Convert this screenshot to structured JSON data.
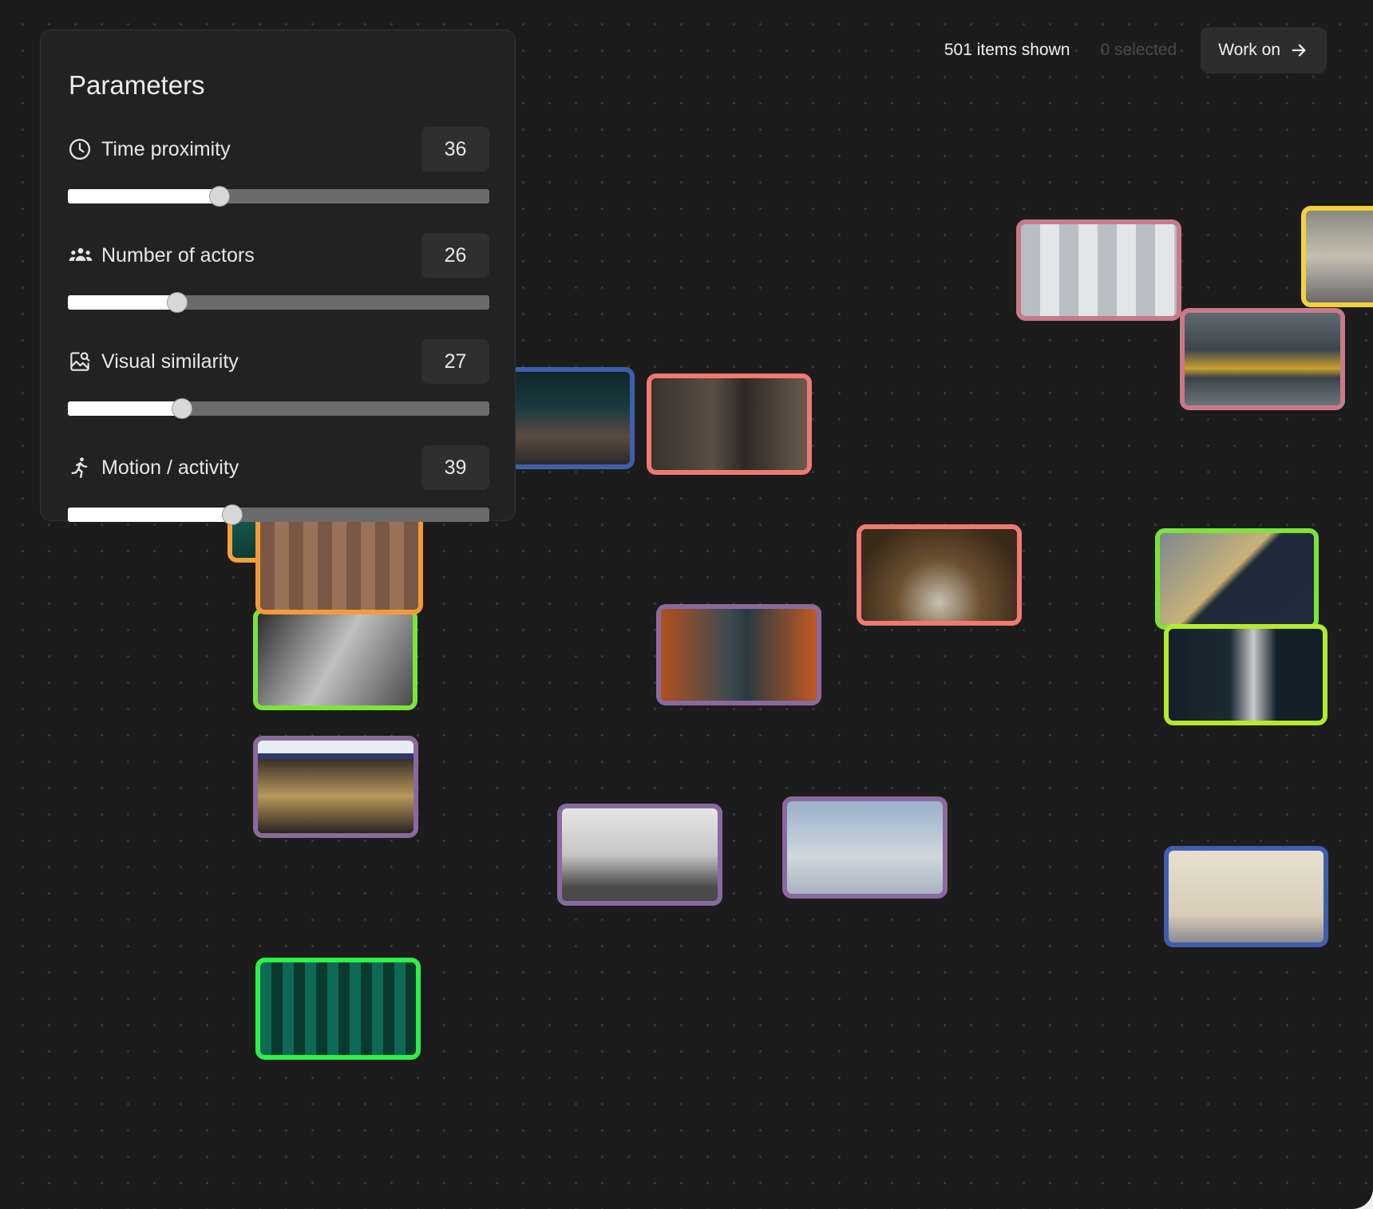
{
  "header": {
    "items_shown": "501 items shown",
    "selected": "0 selected",
    "work_on_label": "Work on"
  },
  "panel": {
    "title": "Parameters",
    "params": [
      {
        "label": "Time proximity",
        "value": "36",
        "level_percent": 36,
        "icon": "clock-icon"
      },
      {
        "label": "Number of actors",
        "value": "26",
        "level_percent": 26,
        "icon": "people-icon"
      },
      {
        "label": "Visual similarity",
        "value": "27",
        "level_percent": 27,
        "icon": "image-search-icon"
      },
      {
        "label": "Motion / activity",
        "value": "39",
        "level_percent": 39,
        "icon": "running-person-icon"
      }
    ]
  },
  "colors": {
    "pink": "#c97a8a",
    "salmon": "#ef7a72",
    "green": "#7be33a",
    "bright_green": "#2ef04a",
    "purple": "#8a6a9e",
    "blue": "#3e5fae",
    "yellow": "#f2d23c",
    "orange": "#f59a3a"
  }
}
